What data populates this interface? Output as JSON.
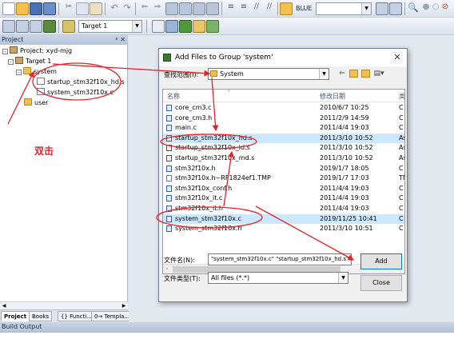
{
  "toolbar": {
    "config_combo": "BLUE",
    "target_combo": "Target 1"
  },
  "project_panel": {
    "title": "Project",
    "tree": {
      "project": "Project: xyd-mjg",
      "target": "Target 1",
      "group_system": "system",
      "file_hd": "startup_stm32f10x_hd.s",
      "file_system": "system_stm32f10x.c",
      "group_user": "user"
    },
    "tabs": [
      "Project",
      "Books",
      "{} Functi...",
      "0→ Templa..."
    ]
  },
  "annotation_label": "双击",
  "build_output": {
    "title": "Build Output"
  },
  "dialog": {
    "title": "Add Files to Group 'system'",
    "look_in_label": "查找范围(I):",
    "look_in_value": "System",
    "columns": {
      "name": "名称",
      "date": "修改日期",
      "type": "类"
    },
    "files": [
      {
        "name": "core_cm3.c",
        "date": "2010/6/7 10:25",
        "type": "C",
        "icon": "src"
      },
      {
        "name": "core_cm3.h",
        "date": "2011/2/9 14:59",
        "type": "C",
        "icon": "src"
      },
      {
        "name": "main.c",
        "date": "2011/4/4 19:03",
        "type": "C",
        "icon": "src"
      },
      {
        "name": "startup_stm32f10x_hd.s",
        "date": "2011/3/10 10:52",
        "type": "As",
        "icon": "asm",
        "selected": true
      },
      {
        "name": "startup_stm32f10x_ld.s",
        "date": "2011/3/10 10:52",
        "type": "As",
        "icon": "asm"
      },
      {
        "name": "startup_stm32f10x_md.s",
        "date": "2011/3/10 10:52",
        "type": "As",
        "icon": "asm"
      },
      {
        "name": "stm32f10x.h",
        "date": "2019/1/7 18:05",
        "type": "C",
        "icon": "src"
      },
      {
        "name": "stm32f10x.h~RF1824ef1.TMP",
        "date": "2019/1/7 17:03",
        "type": "TM",
        "icon": "plain"
      },
      {
        "name": "stm32f10x_conf.h",
        "date": "2011/4/4 19:03",
        "type": "C",
        "icon": "src"
      },
      {
        "name": "stm32f10x_it.c",
        "date": "2011/4/4 19:03",
        "type": "C",
        "icon": "src"
      },
      {
        "name": "stm32f10x_it.h",
        "date": "2011/4/4 19:03",
        "type": "C",
        "icon": "src"
      },
      {
        "name": "system_stm32f10x.c",
        "date": "2019/11/25 10:41",
        "type": "C",
        "icon": "src",
        "selected": true
      },
      {
        "name": "system_stm32f10x.h",
        "date": "2011/3/10 10:51",
        "type": "C",
        "icon": "src"
      }
    ],
    "filename_label": "文件名(N):",
    "filename_value": "\"system_stm32f10x.c\" \"startup_stm32f10x_hd.s\"",
    "filetype_label": "文件类型(T):",
    "filetype_value": "All files (*.*)",
    "add_label": "Add",
    "close_label": "Close"
  },
  "colors": {
    "annotation": "#e8202a",
    "selection": "#cce8ff",
    "dialog_bg": "#f0f0f0"
  }
}
